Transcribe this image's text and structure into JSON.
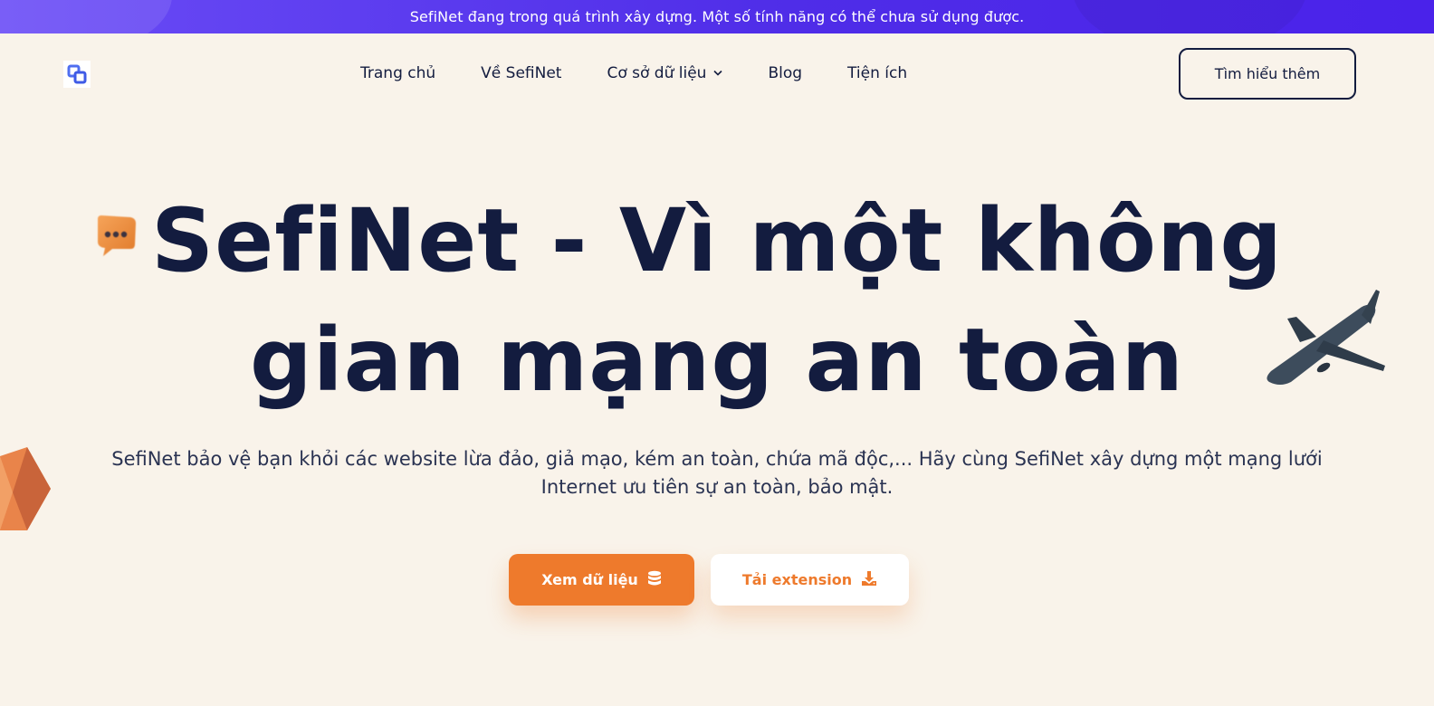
{
  "banner": {
    "text": "SefiNet đang trong quá trình xây dựng. Một số tính năng có thể chưa sử dụng được."
  },
  "header": {
    "logo_icon": "sefinet-logo-icon",
    "nav": [
      {
        "label": "Trang chủ"
      },
      {
        "label": "Về SefiNet"
      },
      {
        "label": "Cơ sở dữ liệu",
        "icon": "chevron-down-icon"
      },
      {
        "label": "Blog"
      },
      {
        "label": "Tiện ích"
      }
    ],
    "cta_label": "Tìm hiểu thêm"
  },
  "hero": {
    "title_line1": "SefiNet - Vì một không",
    "title_line2": "gian mạng an toàn",
    "subtitle": "SefiNet bảo vệ bạn khỏi các website lừa đảo, giả mạo, kém an toàn, chứa mã độc,... Hãy cùng SefiNet xây dựng một mạng lưới Internet ưu tiên sự an toàn, bảo mật.",
    "primary_button": {
      "label": "Xem dữ liệu",
      "icon": "database-icon"
    },
    "secondary_button": {
      "label": "Tải extension",
      "icon": "download-icon"
    }
  },
  "decorations": [
    "chat-bubble-icon",
    "airplane-icon",
    "cube-icon"
  ],
  "colors": {
    "background": "#f9f3ea",
    "banner": "#5a35ef",
    "text_dark": "#131c3f",
    "accent_orange": "#ee7a2c"
  }
}
